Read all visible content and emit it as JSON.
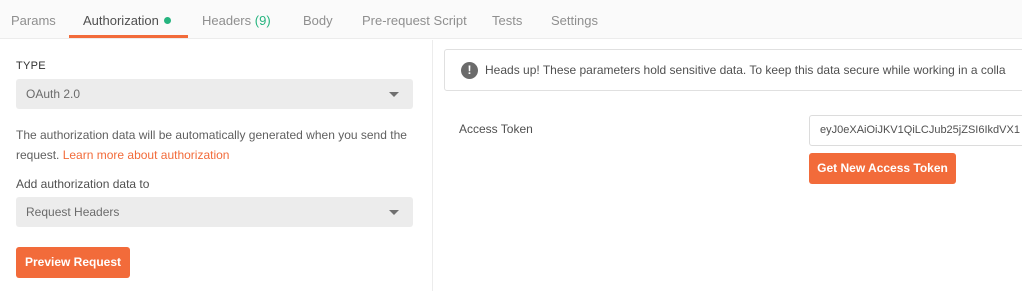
{
  "tabs": [
    {
      "label": "Params"
    },
    {
      "label": "Authorization"
    },
    {
      "label": "Headers",
      "count": "(9)"
    },
    {
      "label": "Body"
    },
    {
      "label": "Pre-request Script"
    },
    {
      "label": "Tests"
    },
    {
      "label": "Settings"
    }
  ],
  "active_tab": "Authorization",
  "left": {
    "type_label": "TYPE",
    "type_value": "OAuth 2.0",
    "description": "The authorization data will be automatically generated when you send the request.",
    "learn_more": "Learn more about authorization",
    "add_to_label": "Add authorization data to",
    "add_to_value": "Request Headers",
    "preview_button": "Preview Request"
  },
  "right": {
    "alert_text": "Heads up! These parameters hold sensitive data. To keep this data secure while working in a colla",
    "access_token_label": "Access Token",
    "access_token_value": "eyJ0eXAiOiJKV1QiLCJub25jZSI6IkdVX1",
    "get_token_button": "Get New Access Token"
  },
  "colors": {
    "accent": "#f26b3a",
    "status_green": "#26b47f"
  },
  "icons": {
    "alert": "info-circle-icon",
    "dropdown": "chevron-down-icon"
  }
}
